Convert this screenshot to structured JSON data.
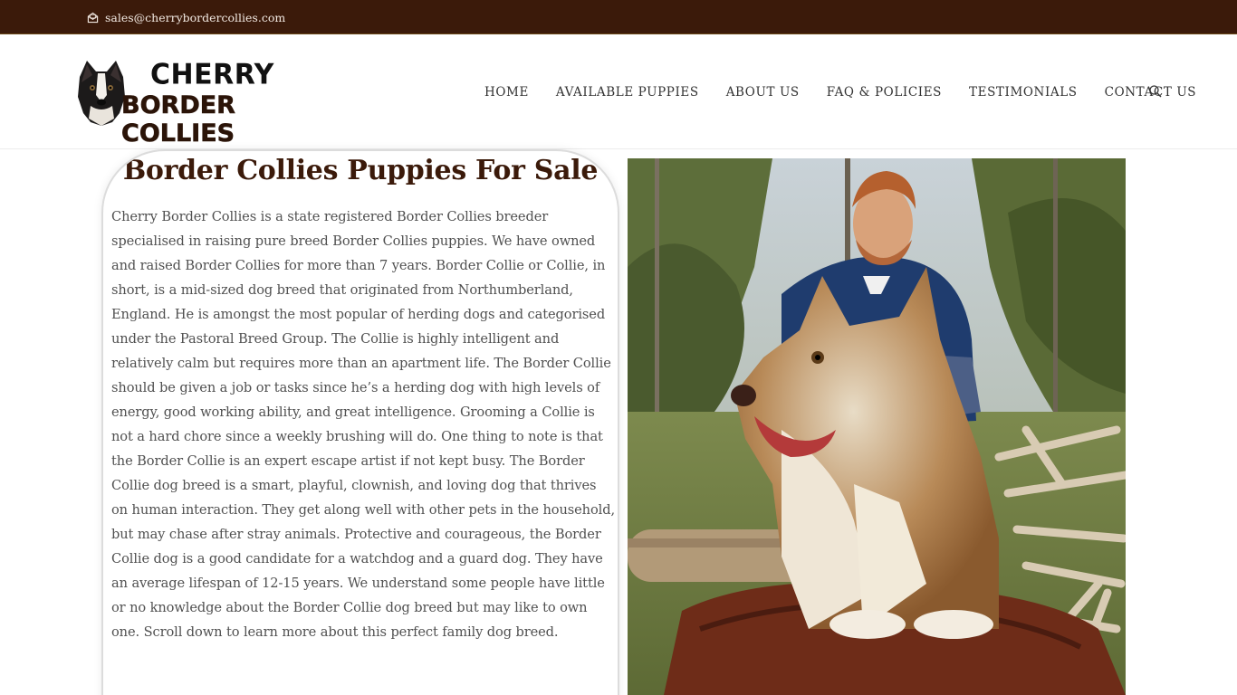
{
  "topbar": {
    "email": "sales@cherrybordercollies.com",
    "email_icon": "envelope-icon"
  },
  "header": {
    "logo": {
      "line1": "CHERRY",
      "line2": "BORDER COLLIES"
    },
    "nav": [
      {
        "label": "HOME"
      },
      {
        "label": "AVAILABLE PUPPIES"
      },
      {
        "label": "ABOUT US"
      },
      {
        "label": "FAQ & POLICIES"
      },
      {
        "label": "TESTIMONIALS"
      },
      {
        "label": "CONTACT US"
      }
    ],
    "search_icon": "search-icon"
  },
  "main": {
    "title": "Border Collies Puppies For Sale",
    "body": "Cherry Border Collies is a state registered Border Collies breeder specialised in raising pure breed Border Collies puppies. We have owned and raised Border Collies for more than 7 years. Border Collie or Collie, in short, is a mid-sized dog breed that originated from Northumberland, England. He is amongst the most popular of herding dogs and categorised under the Pastoral Breed Group. The Collie is highly intelligent and relatively calm but requires more than an apartment life. The Border Collie should be given a job or tasks since he’s a herding dog with high levels of energy, good working ability, and great intelligence. Grooming a Collie is not a hard chore since a weekly brushing will do. One thing to note is that the Border Collie is an expert escape artist if not kept busy. The Border Collie dog breed is a smart, playful, clownish, and loving dog that thrives on human interaction. They get along well with other pets in the household, but may chase after stray animals. Protective and courageous, the Border Collie dog is a good candidate for a watchdog and a guard dog. They have an average lifespan of 12-15 years.  We understand some people have little or no knowledge about the Border Collie dog breed but may like to own one. Scroll down to learn more about this perfect family dog breed."
  },
  "colors": {
    "topbar_bg": "#3b1a0a",
    "title_color": "#3b1a0a",
    "body_text": "#505050"
  }
}
